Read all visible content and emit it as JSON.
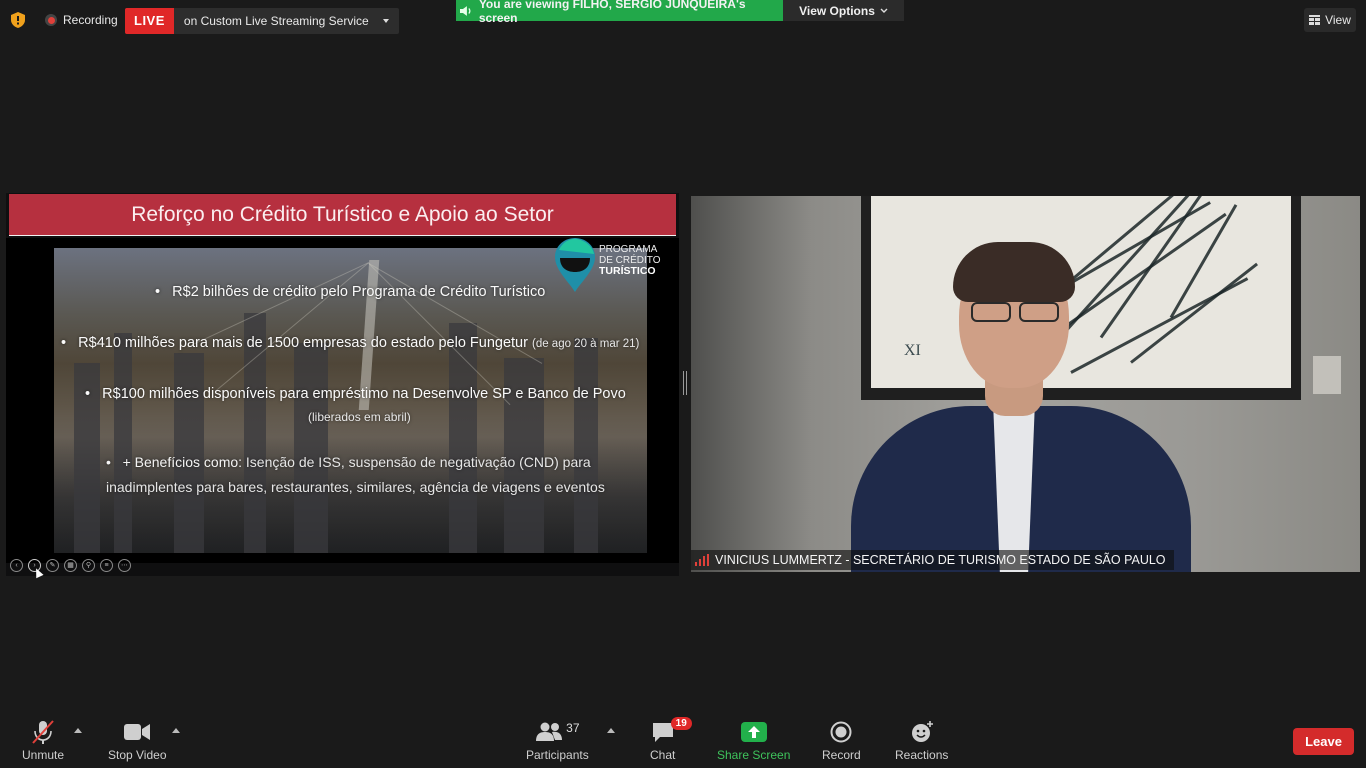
{
  "top_bar": {
    "recording_label": "Recording",
    "live_badge": "LIVE",
    "live_service": "on Custom Live Streaming Service",
    "viewing_banner": "You are viewing FILHO, SERGIO JUNQUEIRA's screen",
    "view_options": "View Options",
    "view_button": "View"
  },
  "slide": {
    "title": "Reforço no Crédito Turístico e Apoio ao Setor",
    "logo": {
      "line1": "PROGRAMA",
      "line2": "DE CRÉDITO",
      "line3": "TURÍSTICO"
    },
    "bullet1": "R$2 bilhões de crédito pelo Programa de Crédito Turístico",
    "bullet2": "R$410 milhões para mais de 1500 empresas do estado pelo Fungetur",
    "bullet2_note": "(de ago 20 à mar 21)",
    "bullet3": "R$100 milhões disponíveis para empréstimo na Desenvolve SP e Banco de Povo",
    "bullet3_note": "(liberados em abril)",
    "bullet4_lead": "+ Benefícios como:",
    "bullet4_rest": "Isenção de ISS, suspensão de negativação (CND) para inadimplentes para bares, restaurantes, similares, agência de viagens e eventos"
  },
  "video": {
    "participant_name": "VINICIUS LUMMERTZ - SECRETÁRIO DE TURISMO ESTADO DE SÃO PAULO",
    "artwork_label": "XI"
  },
  "toolbar": {
    "unmute": "Unmute",
    "stop_video": "Stop Video",
    "participants": "Participants",
    "participants_count": "37",
    "chat": "Chat",
    "chat_badge": "19",
    "share_screen": "Share Screen",
    "record": "Record",
    "reactions": "Reactions",
    "leave": "Leave"
  },
  "colors": {
    "live_red": "#e02828",
    "viewing_green": "#22a84a",
    "slide_title_bg": "#b6303f",
    "share_green": "#3ec35c",
    "leave_red": "#d42b2b"
  }
}
